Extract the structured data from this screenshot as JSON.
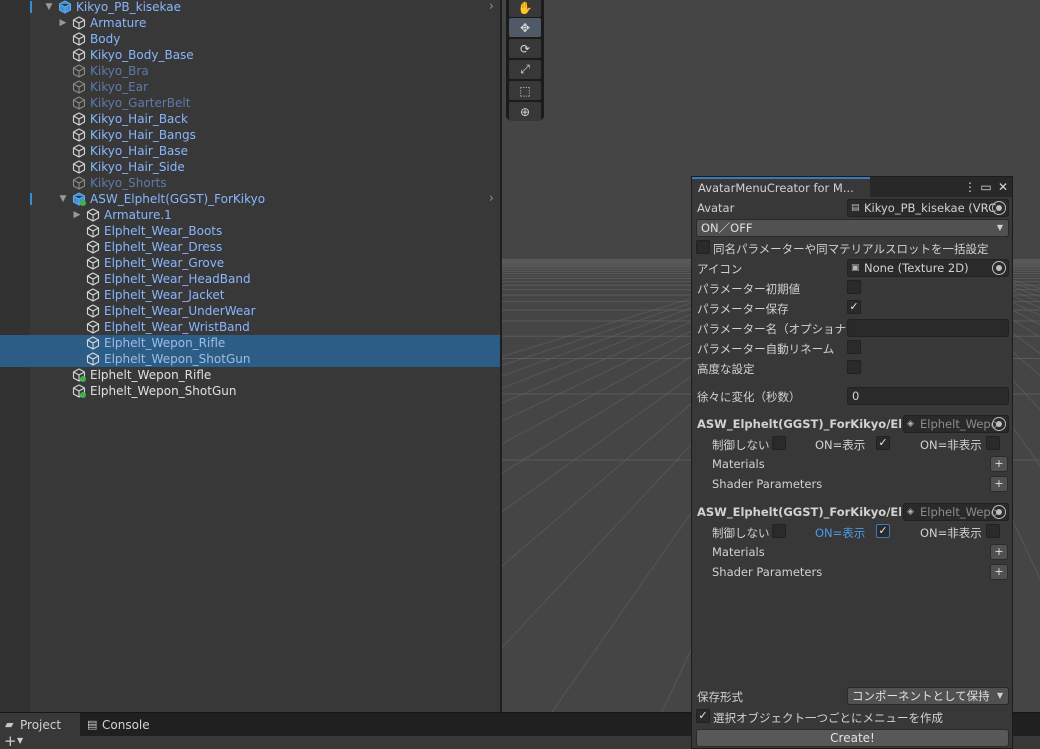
{
  "hierarchy": {
    "rows": [
      {
        "label": "Kikyo_PB_kisekae",
        "fold": "▼",
        "color": "#89b6ff",
        "icon": "prefab-cube-icon"
      },
      {
        "label": "Armature",
        "fold": "▶",
        "color": "#89b6ff",
        "icon": "prefab-cube-icon"
      },
      {
        "label": "Body",
        "color": "#89b6ff",
        "icon": "prefab-cube-icon"
      },
      {
        "label": "Kikyo_Body_Base",
        "color": "#89b6ff",
        "icon": "prefab-cube-icon"
      },
      {
        "label": "Kikyo_Bra",
        "color": "#5d7ba8",
        "icon": "prefab-cube-icon"
      },
      {
        "label": "Kikyo_Ear",
        "color": "#5d7ba8",
        "icon": "prefab-cube-icon"
      },
      {
        "label": "Kikyo_GarterBelt",
        "color": "#5d7ba8",
        "icon": "prefab-cube-icon"
      },
      {
        "label": "Kikyo_Hair_Back",
        "color": "#89b6ff",
        "icon": "prefab-cube-icon"
      },
      {
        "label": "Kikyo_Hair_Bangs",
        "color": "#89b6ff",
        "icon": "prefab-cube-icon"
      },
      {
        "label": "Kikyo_Hair_Base",
        "color": "#89b6ff",
        "icon": "prefab-cube-icon"
      },
      {
        "label": "Kikyo_Hair_Side",
        "color": "#89b6ff",
        "icon": "prefab-cube-icon"
      },
      {
        "label": "Kikyo_Shorts",
        "color": "#5d7ba8",
        "icon": "prefab-cube-icon"
      },
      {
        "label": "ASW_Elphelt(GGST)_ForKikyo",
        "fold": "▼",
        "color": "#89b6ff",
        "icon": "prefab-added-icon"
      },
      {
        "label": "Armature.1",
        "fold": "▶",
        "color": "#89b6ff",
        "icon": "prefab-cube-icon"
      },
      {
        "label": "Elphelt_Wear_Boots",
        "color": "#89b6ff",
        "icon": "prefab-cube-icon"
      },
      {
        "label": "Elphelt_Wear_Dress",
        "color": "#89b6ff",
        "icon": "prefab-cube-icon"
      },
      {
        "label": "Elphelt_Wear_Grove",
        "color": "#89b6ff",
        "icon": "prefab-cube-icon"
      },
      {
        "label": "Elphelt_Wear_HeadBand",
        "color": "#89b6ff",
        "icon": "prefab-cube-icon"
      },
      {
        "label": "Elphelt_Wear_Jacket",
        "color": "#89b6ff",
        "icon": "prefab-cube-icon"
      },
      {
        "label": "Elphelt_Wear_UnderWear",
        "color": "#89b6ff",
        "icon": "prefab-cube-icon"
      },
      {
        "label": "Elphelt_Wear_WristBand",
        "color": "#89b6ff",
        "icon": "prefab-cube-icon"
      },
      {
        "label": "Elphelt_Wepon_Rifle",
        "color": "#9fbde0",
        "icon": "prefab-cube-icon"
      },
      {
        "label": "Elphelt_Wepon_ShotGun",
        "color": "#9fbde0",
        "icon": "prefab-cube-icon"
      },
      {
        "label": "Elphelt_Wepon_Rifle",
        "color": "#e0e0e0",
        "icon": "gameobject-added-icon"
      },
      {
        "label": "Elphelt_Wepon_ShotGun",
        "color": "#e0e0e0",
        "icon": "gameobject-added-icon"
      }
    ]
  },
  "scene_tools": [
    "hand-tool-icon",
    "move-tool-icon",
    "rotate-tool-icon",
    "scale-tool-icon",
    "rect-tool-icon",
    "transform-tool-icon"
  ],
  "bottom_tabs": {
    "project": "Project",
    "console": "Console"
  },
  "window": {
    "title": "AvatarMenuCreator for M...",
    "avatar_label": "Avatar",
    "avatar_value": "Kikyo_PB_kisekae (VRC",
    "mode": "ON／OFF",
    "bulk_setting": "同名パラメーターや同マテリアルスロットを一括設定",
    "icon_label": "アイコン",
    "icon_value": "None (Texture 2D)",
    "param_default": "パラメーター初期値",
    "param_saved": "パラメーター保存",
    "param_name": "パラメーター名（オプショナル）",
    "param_rename": "パラメーター自動リネーム",
    "advanced": "高度な設定",
    "transition_label": "徐々に変化（秒数）",
    "transition_value": "0",
    "targets": [
      {
        "path": "ASW_Elphelt(GGST)_ForKikyo/Elph",
        "object": "Elphelt_Wepo",
        "no_control": "制御しない",
        "on_show": "ON=表示",
        "on_hide": "ON=非表示",
        "materials": "Materials",
        "shader_params": "Shader Parameters"
      },
      {
        "path": "ASW_Elphelt(GGST)_ForKikyo/Elph",
        "object": "Elphelt_Wepo",
        "no_control": "制御しない",
        "on_show": "ON=表示",
        "on_hide": "ON=非表示",
        "materials": "Materials",
        "shader_params": "Shader Parameters"
      }
    ],
    "save_format_label": "保存形式",
    "save_format_value": "コンポーネントとして保持",
    "per_object_menu": "選択オブジェクト一つごとにメニューを作成",
    "create_button": "Create!"
  }
}
